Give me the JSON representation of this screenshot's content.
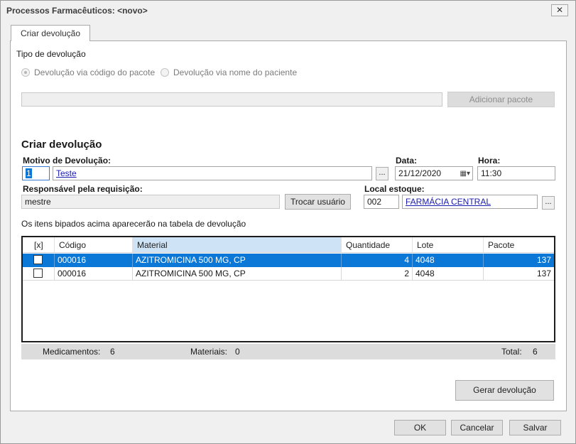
{
  "window": {
    "title": "Processos Farmacêuticos: <novo>",
    "close_glyph": "✕"
  },
  "tab": {
    "label": "Criar devolução"
  },
  "tipo": {
    "label": "Tipo de devolução",
    "option1": "Devolução via código do pacote",
    "option2": "Devolução via nome do paciente",
    "package_input_value": "",
    "add_package_button": "Adicionar pacote"
  },
  "section": {
    "title": "Criar devolução"
  },
  "motivo": {
    "label": "Motivo de Devolução:",
    "code": "1",
    "text": "Teste",
    "lookup": "..."
  },
  "data": {
    "label": "Data:",
    "value": "21/12/2020"
  },
  "hora": {
    "label": "Hora:",
    "value": "11:30"
  },
  "responsavel": {
    "label": "Responsável pela requisição:",
    "value": "mestre",
    "button": "Trocar usuário"
  },
  "local": {
    "label": "Local estoque:",
    "code": "002",
    "name": "FARMÁCIA CENTRAL",
    "lookup": "..."
  },
  "info_text": "Os itens bipados acima aparecerão na tabela de devolução",
  "table": {
    "headers": {
      "check": "[x]",
      "codigo": "Código",
      "material": "Material",
      "quantidade": "Quantidade",
      "lote": "Lote",
      "pacote": "Pacote"
    },
    "rows": [
      {
        "checked": false,
        "codigo": "000016",
        "material": "AZITROMICINA 500 MG, CP",
        "quantidade": "4",
        "lote": "4048",
        "pacote": "137"
      },
      {
        "checked": false,
        "codigo": "000016",
        "material": "AZITROMICINA 500 MG, CP",
        "quantidade": "2",
        "lote": "4048",
        "pacote": "137"
      }
    ]
  },
  "summary": {
    "medicamentos_label": "Medicamentos:",
    "medicamentos_value": "6",
    "materiais_label": "Materiais:",
    "materiais_value": "0",
    "total_label": "Total:",
    "total_value": "6"
  },
  "buttons": {
    "gerar": "Gerar devolução",
    "ok": "OK",
    "cancelar": "Cancelar",
    "salvar": "Salvar"
  },
  "colors": {
    "selection": "#0b78d7",
    "link": "#1a1ab0"
  }
}
